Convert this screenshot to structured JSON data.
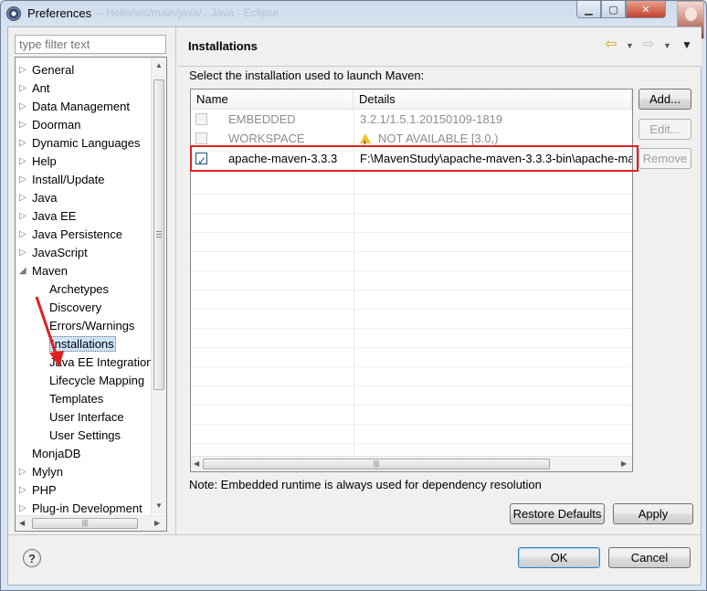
{
  "window": {
    "title": "Preferences",
    "background_title": "– Hello/src/main/java/...Java - Eclipse"
  },
  "filter": {
    "placeholder": "type filter text"
  },
  "tree": {
    "items": [
      {
        "label": "General",
        "expandable": true,
        "expanded": false,
        "level": 0
      },
      {
        "label": "Ant",
        "expandable": true,
        "expanded": false,
        "level": 0
      },
      {
        "label": "Data Management",
        "expandable": true,
        "expanded": false,
        "level": 0
      },
      {
        "label": "Doorman",
        "expandable": true,
        "expanded": false,
        "level": 0
      },
      {
        "label": "Dynamic Languages",
        "expandable": true,
        "expanded": false,
        "level": 0
      },
      {
        "label": "Help",
        "expandable": true,
        "expanded": false,
        "level": 0
      },
      {
        "label": "Install/Update",
        "expandable": true,
        "expanded": false,
        "level": 0
      },
      {
        "label": "Java",
        "expandable": true,
        "expanded": false,
        "level": 0
      },
      {
        "label": "Java EE",
        "expandable": true,
        "expanded": false,
        "level": 0
      },
      {
        "label": "Java Persistence",
        "expandable": true,
        "expanded": false,
        "level": 0
      },
      {
        "label": "JavaScript",
        "expandable": true,
        "expanded": false,
        "level": 0
      },
      {
        "label": "Maven",
        "expandable": true,
        "expanded": true,
        "level": 0
      },
      {
        "label": "Archetypes",
        "expandable": false,
        "level": 1
      },
      {
        "label": "Discovery",
        "expandable": false,
        "level": 1
      },
      {
        "label": "Errors/Warnings",
        "expandable": false,
        "level": 1
      },
      {
        "label": "Installations",
        "expandable": false,
        "level": 1,
        "selected": true
      },
      {
        "label": "Java EE Integration",
        "expandable": false,
        "level": 1
      },
      {
        "label": "Lifecycle Mapping",
        "expandable": false,
        "level": 1
      },
      {
        "label": "Templates",
        "expandable": false,
        "level": 1
      },
      {
        "label": "User Interface",
        "expandable": false,
        "level": 1
      },
      {
        "label": "User Settings",
        "expandable": false,
        "level": 1
      },
      {
        "label": "MonjaDB",
        "expandable": false,
        "level": 0
      },
      {
        "label": "Mylyn",
        "expandable": true,
        "expanded": false,
        "level": 0
      },
      {
        "label": "PHP",
        "expandable": true,
        "expanded": false,
        "level": 0
      },
      {
        "label": "Plug-in Development",
        "expandable": true,
        "expanded": false,
        "level": 0
      }
    ]
  },
  "page": {
    "title": "Installations",
    "description": "Select the installation used to launch Maven:",
    "table": {
      "headers": {
        "name": "Name",
        "details": "Details"
      },
      "rows": [
        {
          "name": "EMBEDDED",
          "details": "3.2.1/1.5.1.20150109-1819",
          "checked": false,
          "enabled": false,
          "warning": false
        },
        {
          "name": "WORKSPACE",
          "details": "NOT AVAILABLE [3.0,)",
          "checked": false,
          "enabled": false,
          "warning": true
        },
        {
          "name": "apache-maven-3.3.3",
          "details": "F:\\MavenStudy\\apache-maven-3.3.3-bin\\apache-ma",
          "checked": true,
          "enabled": true,
          "warning": false
        }
      ]
    },
    "buttons": {
      "add": "Add...",
      "edit": "Edit...",
      "remove": "Remove"
    },
    "note": "Note: Embedded runtime is always used for dependency resolution",
    "restore_defaults": "Restore Defaults",
    "apply": "Apply"
  },
  "dialog": {
    "ok": "OK",
    "cancel": "Cancel"
  },
  "colors": {
    "highlight": "#e02020",
    "selection": "#cde4fb",
    "accent": "#3c7fb1"
  },
  "icons": {
    "app": "eclipse-icon",
    "back": "back-arrow-icon",
    "forward": "forward-arrow-icon",
    "menu": "view-menu-icon",
    "warning": "warning-icon",
    "help": "help-icon",
    "annotation": "red-arrow-annotation"
  }
}
